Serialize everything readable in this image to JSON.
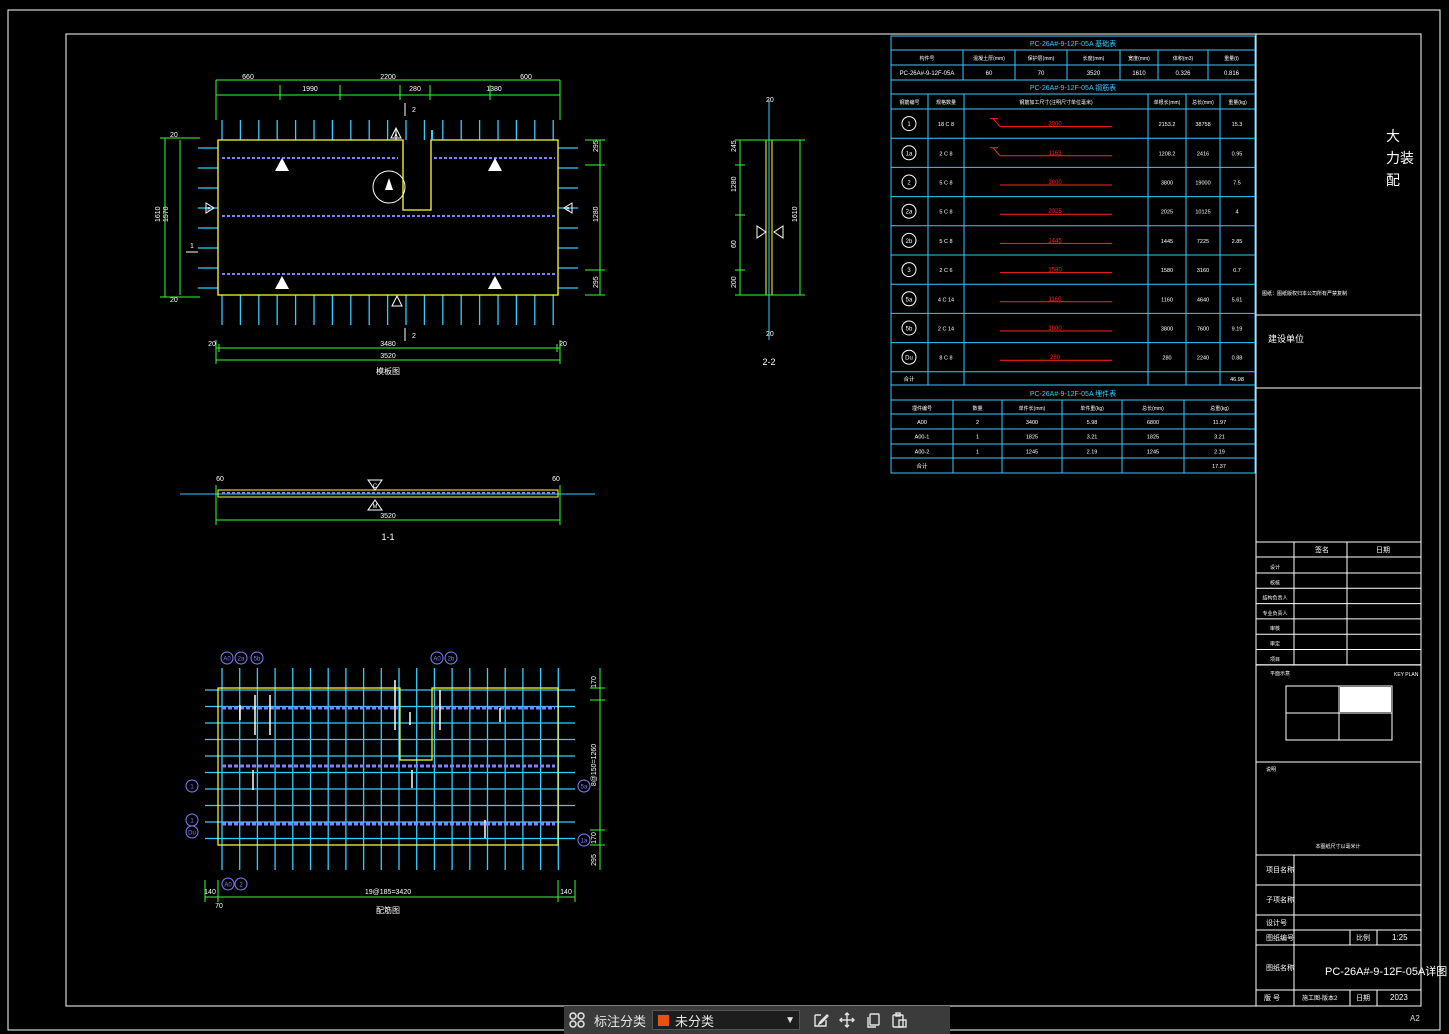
{
  "colors": {
    "frame": "#ffffff",
    "cyan": "#33ccff",
    "green": "#33ff33",
    "yellow": "#ffff33",
    "purple": "#8080ff",
    "red": "#ff2222",
    "blue": "#5555ff",
    "toolbar_bg": "#3b3b3b",
    "swatch": "#e8520e"
  },
  "views": {
    "plan": {
      "title": "模板图",
      "top_dims": [
        "660",
        "1990",
        "2200",
        "280",
        "1380",
        "600"
      ],
      "bottom_dims": [
        "20",
        "3480",
        "20",
        "3520"
      ],
      "left_dims": [
        "20",
        "1570",
        "1610",
        "20"
      ],
      "right_dims": [
        "295",
        "1280",
        "295"
      ],
      "section_mark_2": "2",
      "section_mark_1": "1",
      "markers": [
        "A",
        "A",
        "B",
        "B"
      ]
    },
    "section11": {
      "title": "1-1",
      "dims": [
        "60",
        "60",
        "3520"
      ],
      "marks": [
        "C",
        "M"
      ]
    },
    "section22": {
      "title": "2-2",
      "dims": [
        "245",
        "1280",
        "60",
        "295",
        "1610",
        "200",
        "20",
        "20"
      ],
      "marks": [
        "A",
        "B"
      ]
    },
    "rebar": {
      "title": "配筋图",
      "callouts_top": [
        "A0",
        "2a",
        "5b",
        "A0",
        "2b"
      ],
      "callouts_left": [
        "1",
        "1",
        "Du"
      ],
      "callouts_right": [
        "5a",
        "1a"
      ],
      "callouts_bottom": [
        "A0",
        "2"
      ],
      "bottom_dims": [
        "140",
        "19@185=3420",
        "140",
        "70",
        "70"
      ],
      "right_dims": [
        "170",
        "8@150=1260",
        "170",
        "295"
      ]
    }
  },
  "table_basic": {
    "title": "PC-26A#-9-12F-05A 基础表",
    "headers": [
      "构件号",
      "混凝土厚(mm)",
      "保护层(mm)",
      "长度(mm)",
      "宽度(mm)",
      "体积(m3)",
      "重量(t)"
    ],
    "row": [
      "PC-26A#-9-12F-05A",
      "60",
      "70",
      "3520",
      "1610",
      "0.326",
      "0.816"
    ]
  },
  "table_rebar": {
    "title": "PC-26A#-9-12F-05A 钢筋表",
    "headers": [
      "钢筋编号",
      "规格数量",
      "钢筋加工尺寸(注明尺寸单位毫米)",
      "单根长(mm)",
      "总长(mm)",
      "重量(kg)"
    ],
    "rows": [
      {
        "no": "1",
        "spec": "18 C 8",
        "shape": "3000",
        "len": "2153.2",
        "total": "38758",
        "wt": "15.3"
      },
      {
        "no": "1a",
        "spec": "2 C 8",
        "shape": "1163",
        "len": "1208.2",
        "total": "2416",
        "wt": "0.95"
      },
      {
        "no": "2",
        "spec": "5 C 8",
        "shape": "3800",
        "len": "3800",
        "total": "19000",
        "wt": "7.5"
      },
      {
        "no": "2a",
        "spec": "5 C 8",
        "shape": "2025",
        "len": "2025",
        "total": "10125",
        "wt": "4"
      },
      {
        "no": "2b",
        "spec": "5 C 8",
        "shape": "1445",
        "len": "1445",
        "total": "7225",
        "wt": "2.85"
      },
      {
        "no": "3",
        "spec": "2 C 6",
        "shape": "1580",
        "len": "1580",
        "total": "3160",
        "wt": "0.7"
      },
      {
        "no": "5a",
        "spec": "4 C 14",
        "shape": "1160",
        "len": "1160",
        "total": "4640",
        "wt": "5.61"
      },
      {
        "no": "5b",
        "spec": "2 C 14",
        "shape": "3800",
        "len": "3800",
        "total": "7600",
        "wt": "9.19"
      },
      {
        "no": "Du",
        "spec": "8 C 8",
        "shape": "280",
        "len": "280",
        "total": "2240",
        "wt": "0.88"
      }
    ],
    "total_label": "合计",
    "total": "46.98"
  },
  "table_embed": {
    "title": "PC-26A#-9-12F-05A 埋件表",
    "headers": [
      "埋件编号",
      "数量",
      "单件长(mm)",
      "单件重(kg)",
      "总长(mm)",
      "总重(kg)"
    ],
    "rows": [
      [
        "A00",
        "2",
        "3400",
        "5.98",
        "6800",
        "11.97"
      ],
      [
        "A00-1",
        "1",
        "1825",
        "3.21",
        "1825",
        "3.21"
      ],
      [
        "A00-2",
        "1",
        "1245",
        "2.19",
        "1245",
        "2.19"
      ]
    ],
    "total_label": "合计",
    "total": "17.37"
  },
  "title_block": {
    "logo_text": [
      "大",
      "力装",
      "配"
    ],
    "company_line": "图纸：图纸版权归本公司所有严禁复制",
    "construction_unit": "建设单位",
    "sign_headers": [
      "签名",
      "日期"
    ],
    "sign_rows": [
      "设计",
      "校核",
      "结构负责人",
      "专业负责人",
      "审核",
      "审定",
      "项目"
    ],
    "key_plan_label": "平面示意",
    "key_plan_right": "KEY PLAN",
    "note_label": "说明",
    "note_center": "本图纸尺寸以毫米计",
    "project_name": "项目名称",
    "sub_project": "子项名称",
    "design_no": "设计号",
    "drawing_no_label": "图纸编号",
    "scale_label": "比例",
    "scale": "1:25",
    "drawing_name_label": "图纸名称",
    "drawing_name": "PC-26A#-9-12F-05A详图",
    "version_label": "版    号",
    "version_value": "施工图-版本2",
    "date_label": "日期",
    "date": "2023"
  },
  "toolbar": {
    "icons": [
      "grid-icon",
      "edit-icon",
      "move-icon",
      "copy-icon",
      "paste-icon"
    ],
    "label": "标注分类",
    "select_value": "未分类"
  },
  "layout_tag": "A2"
}
